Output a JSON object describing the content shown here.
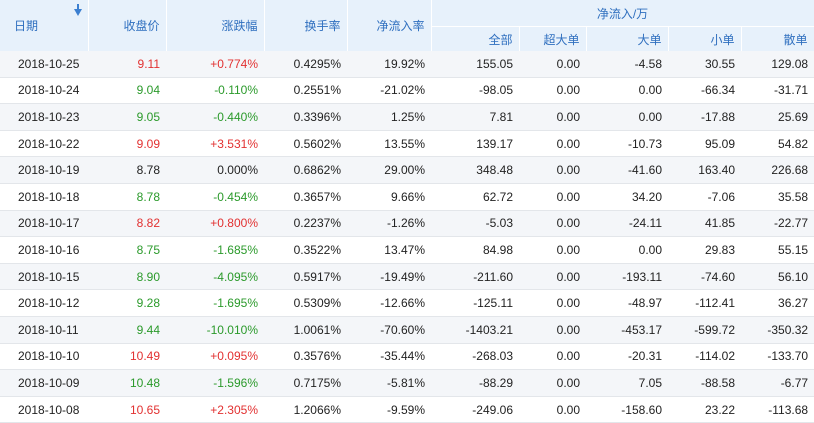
{
  "headers": {
    "date": "日期",
    "close": "收盘价",
    "change": "涨跌幅",
    "turnover": "换手率",
    "inflow_rate": "净流入率",
    "net_group": "净流入/万",
    "all": "全部",
    "super": "超大单",
    "big": "大单",
    "small": "小单",
    "retail": "散单"
  },
  "colors": {
    "up": "#e23131",
    "down": "#2b9a2b",
    "header_bg": "#e7f1fb",
    "header_text": "#2f6fbf"
  },
  "icons": {
    "sort": "sort-descending-icon"
  },
  "rows": [
    {
      "date": "2018-10-25",
      "close": "9.11",
      "change": "+0.774%",
      "dir": "up",
      "turnover": "0.4295%",
      "inflow_rate": "19.92%",
      "all": "155.05",
      "super": "0.00",
      "big": "-4.58",
      "small": "30.55",
      "retail": "129.08"
    },
    {
      "date": "2018-10-24",
      "close": "9.04",
      "change": "-0.110%",
      "dir": "down",
      "turnover": "0.2551%",
      "inflow_rate": "-21.02%",
      "all": "-98.05",
      "super": "0.00",
      "big": "0.00",
      "small": "-66.34",
      "retail": "-31.71"
    },
    {
      "date": "2018-10-23",
      "close": "9.05",
      "change": "-0.440%",
      "dir": "down",
      "turnover": "0.3396%",
      "inflow_rate": "1.25%",
      "all": "7.81",
      "super": "0.00",
      "big": "0.00",
      "small": "-17.88",
      "retail": "25.69"
    },
    {
      "date": "2018-10-22",
      "close": "9.09",
      "change": "+3.531%",
      "dir": "up",
      "turnover": "0.5602%",
      "inflow_rate": "13.55%",
      "all": "139.17",
      "super": "0.00",
      "big": "-10.73",
      "small": "95.09",
      "retail": "54.82"
    },
    {
      "date": "2018-10-19",
      "close": "8.78",
      "change": "0.000%",
      "dir": "flat",
      "turnover": "0.6862%",
      "inflow_rate": "29.00%",
      "all": "348.48",
      "super": "0.00",
      "big": "-41.60",
      "small": "163.40",
      "retail": "226.68"
    },
    {
      "date": "2018-10-18",
      "close": "8.78",
      "change": "-0.454%",
      "dir": "down",
      "turnover": "0.3657%",
      "inflow_rate": "9.66%",
      "all": "62.72",
      "super": "0.00",
      "big": "34.20",
      "small": "-7.06",
      "retail": "35.58"
    },
    {
      "date": "2018-10-17",
      "close": "8.82",
      "change": "+0.800%",
      "dir": "up",
      "turnover": "0.2237%",
      "inflow_rate": "-1.26%",
      "all": "-5.03",
      "super": "0.00",
      "big": "-24.11",
      "small": "41.85",
      "retail": "-22.77"
    },
    {
      "date": "2018-10-16",
      "close": "8.75",
      "change": "-1.685%",
      "dir": "down",
      "turnover": "0.3522%",
      "inflow_rate": "13.47%",
      "all": "84.98",
      "super": "0.00",
      "big": "0.00",
      "small": "29.83",
      "retail": "55.15"
    },
    {
      "date": "2018-10-15",
      "close": "8.90",
      "change": "-4.095%",
      "dir": "down",
      "turnover": "0.5917%",
      "inflow_rate": "-19.49%",
      "all": "-211.60",
      "super": "0.00",
      "big": "-193.11",
      "small": "-74.60",
      "retail": "56.10"
    },
    {
      "date": "2018-10-12",
      "close": "9.28",
      "change": "-1.695%",
      "dir": "down",
      "turnover": "0.5309%",
      "inflow_rate": "-12.66%",
      "all": "-125.11",
      "super": "0.00",
      "big": "-48.97",
      "small": "-112.41",
      "retail": "36.27"
    },
    {
      "date": "2018-10-11",
      "close": "9.44",
      "change": "-10.010%",
      "dir": "down",
      "turnover": "1.0061%",
      "inflow_rate": "-70.60%",
      "all": "-1403.21",
      "super": "0.00",
      "big": "-453.17",
      "small": "-599.72",
      "retail": "-350.32"
    },
    {
      "date": "2018-10-10",
      "close": "10.49",
      "change": "+0.095%",
      "dir": "up",
      "turnover": "0.3576%",
      "inflow_rate": "-35.44%",
      "all": "-268.03",
      "super": "0.00",
      "big": "-20.31",
      "small": "-114.02",
      "retail": "-133.70"
    },
    {
      "date": "2018-10-09",
      "close": "10.48",
      "change": "-1.596%",
      "dir": "down",
      "turnover": "0.7175%",
      "inflow_rate": "-5.81%",
      "all": "-88.29",
      "super": "0.00",
      "big": "7.05",
      "small": "-88.58",
      "retail": "-6.77"
    },
    {
      "date": "2018-10-08",
      "close": "10.65",
      "change": "+2.305%",
      "dir": "up",
      "turnover": "1.2066%",
      "inflow_rate": "-9.59%",
      "all": "-249.06",
      "super": "0.00",
      "big": "-158.60",
      "small": "23.22",
      "retail": "-113.68"
    }
  ]
}
